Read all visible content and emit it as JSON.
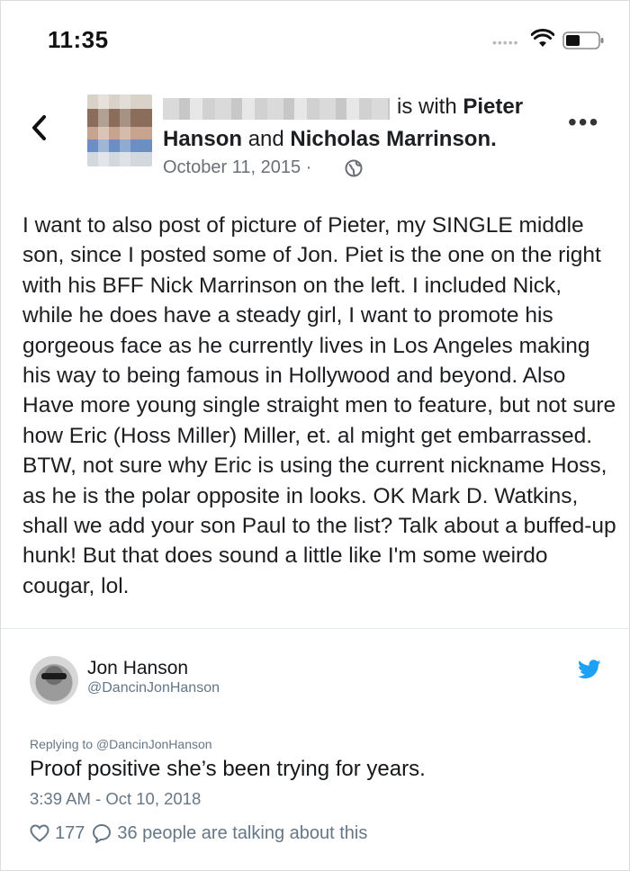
{
  "status_bar": {
    "time": "11:35",
    "signal": "•••••"
  },
  "post": {
    "header_with": "is with",
    "tag1_first": "Pieter",
    "tag1_last": "Hanson",
    "and": "and",
    "tag2": "Nicholas Marrinson.",
    "date": "October 11, 2015 ·",
    "body": "I want to also post of picture of Pieter, my SINGLE middle son, since I posted some of Jon.  Piet is the one on the right with his BFF Nick Marrinson on the left.  I included Nick, while he does have a steady girl, I want to promote his gorgeous face as he currently lives in Los Angeles making his way to being famous in Hollywood and beyond.  Also Have more young single straight men to feature, but not sure how Eric (Hoss Miller) Miller, et. al might get embarrassed. BTW, not sure why Eric is using the current nickname Hoss, as he is the polar opposite in looks.  OK  Mark D. Watkins, shall we add your son Paul to the list? Talk about a buffed-up hunk!  But that does sound a little like I'm some weirdo cougar, lol.",
    "more_label": "•••"
  },
  "tweet": {
    "name": "Jon Hanson",
    "handle": "@DancinJonHanson",
    "replying_prefix": "Replying to",
    "replying_handle": "@DancinJonHanson",
    "text": "Proof positive she’s been trying for years.",
    "timestamp": "3:39 AM - Oct 10, 2018",
    "likes": "177",
    "talking": "36 people are talking about this",
    "brand_color": "#1da1f2"
  }
}
